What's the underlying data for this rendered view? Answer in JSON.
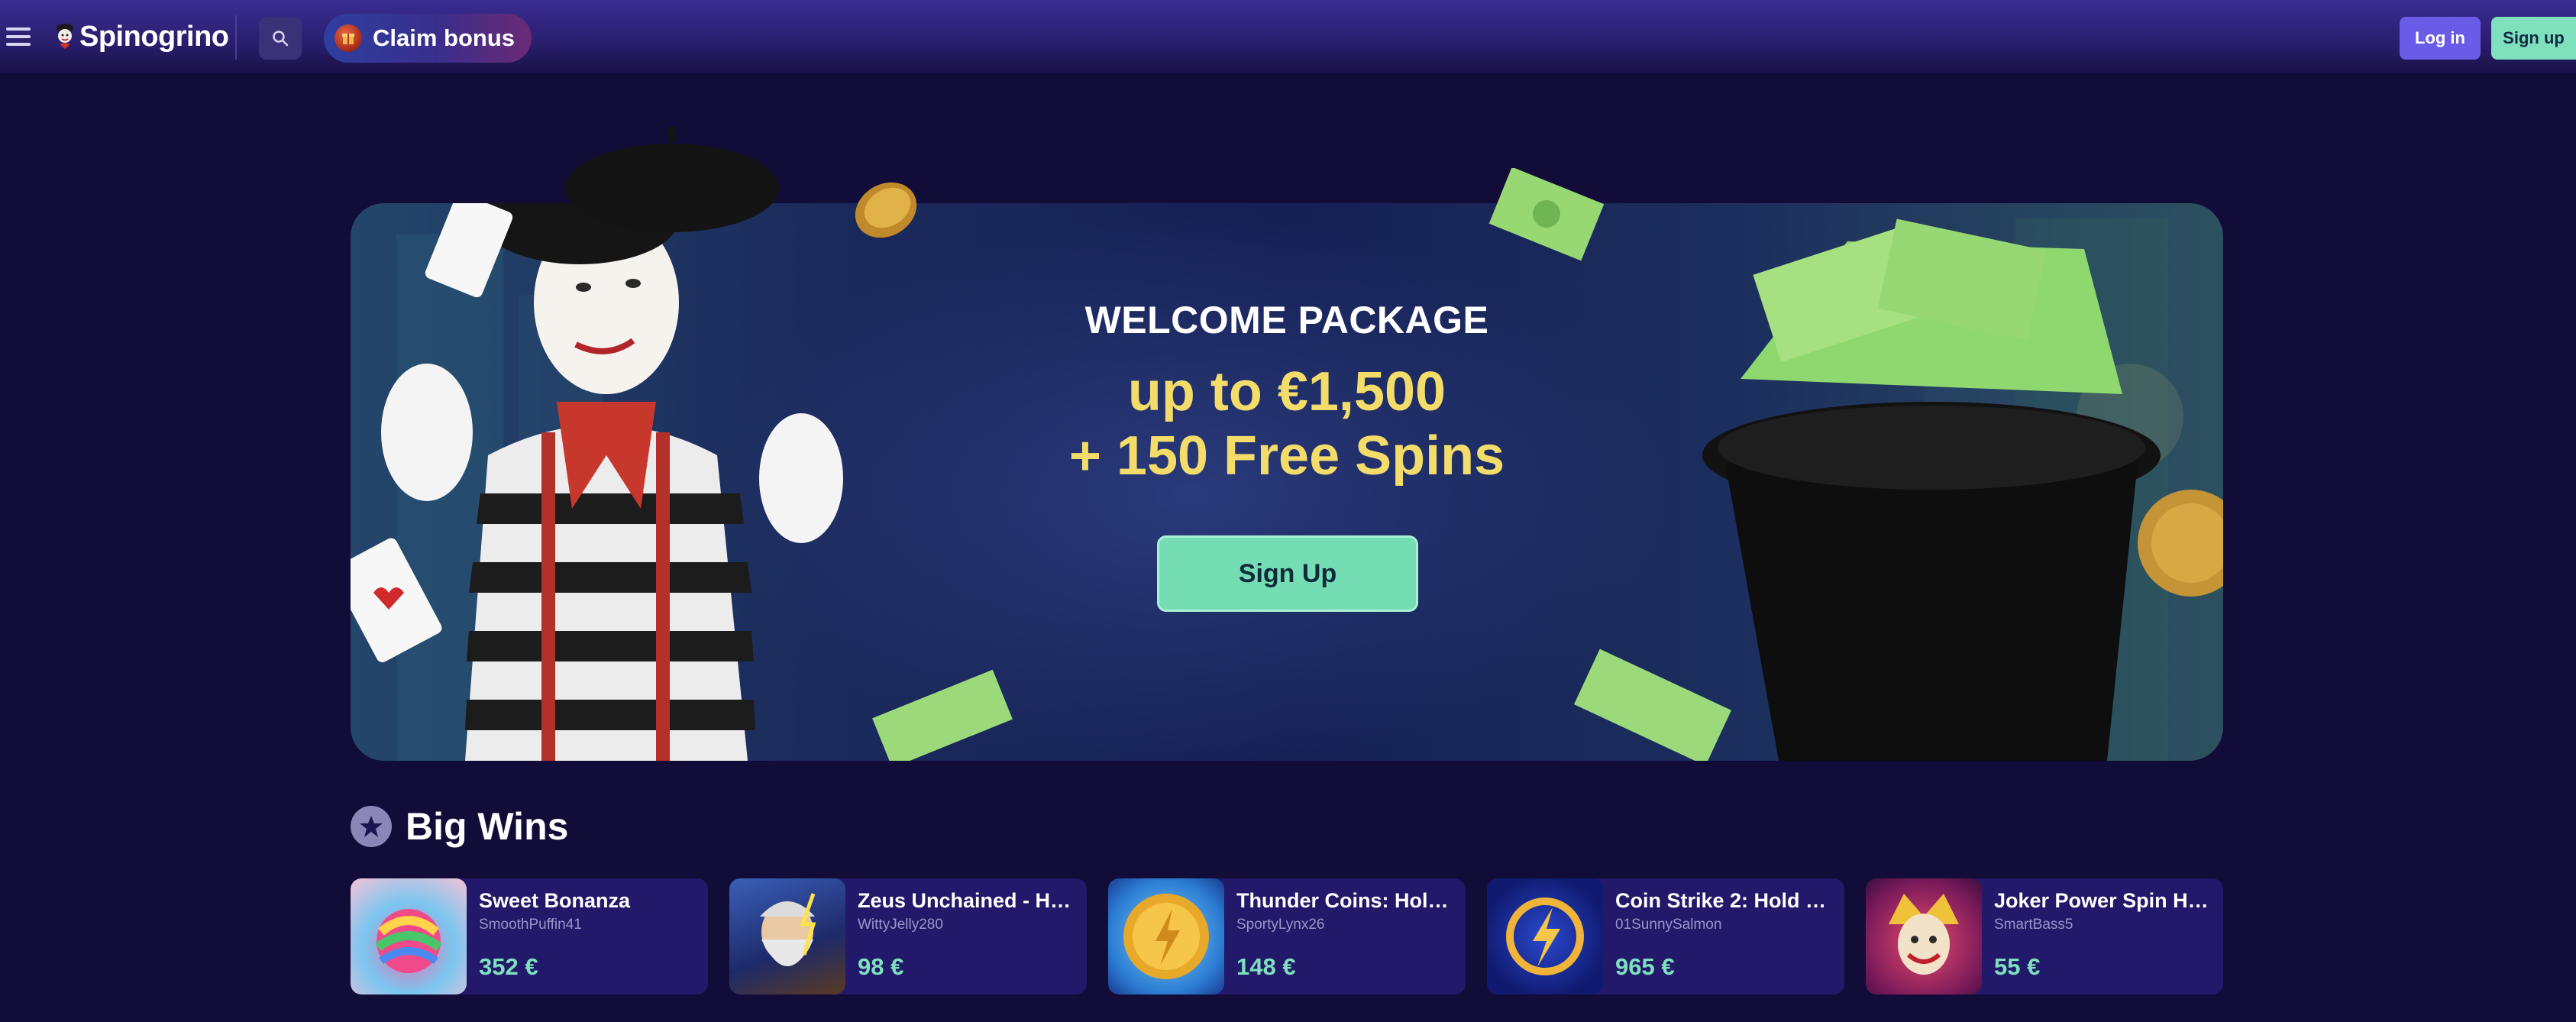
{
  "header": {
    "logo_text": "Spinogrino",
    "claim_bonus_label": "Claim bonus",
    "login_label": "Log in",
    "signup_label": "Sign up"
  },
  "hero": {
    "eyebrow": "WELCOME PACKAGE",
    "line1": "up to €1,500",
    "line2": "+ 150 Free Spins",
    "cta_label": "Sign Up"
  },
  "big_wins": {
    "title": "Big Wins",
    "items": [
      {
        "game": "Sweet Bonanza",
        "user": "SmoothPuffin41",
        "amount": "352 €",
        "thumb": "sweet-bonanza"
      },
      {
        "game": "Zeus Unchained - Hol...",
        "user": "WittyJelly280",
        "amount": "98 €",
        "thumb": "zeus-unchained"
      },
      {
        "game": "Thunder Coins: Hold ...",
        "user": "SportyLynx26",
        "amount": "148 €",
        "thumb": "thunder-coins"
      },
      {
        "game": "Coin Strike 2: Hold an...",
        "user": "01SunnySalmon",
        "amount": "965 €",
        "thumb": "coin-strike-2"
      },
      {
        "game": "Joker Power Spin Hol...",
        "user": "SmartBass5",
        "amount": "55 €",
        "thumb": "joker-power-spin"
      }
    ]
  },
  "colors": {
    "background": "#120c38",
    "accent_green": "#7ee0bd",
    "accent_purple": "#6a5ce6",
    "hero_gold": "#f3dc6a"
  },
  "icons": [
    "hamburger-menu-icon",
    "search-icon",
    "bonus-gift-icon",
    "star-badge-icon"
  ]
}
